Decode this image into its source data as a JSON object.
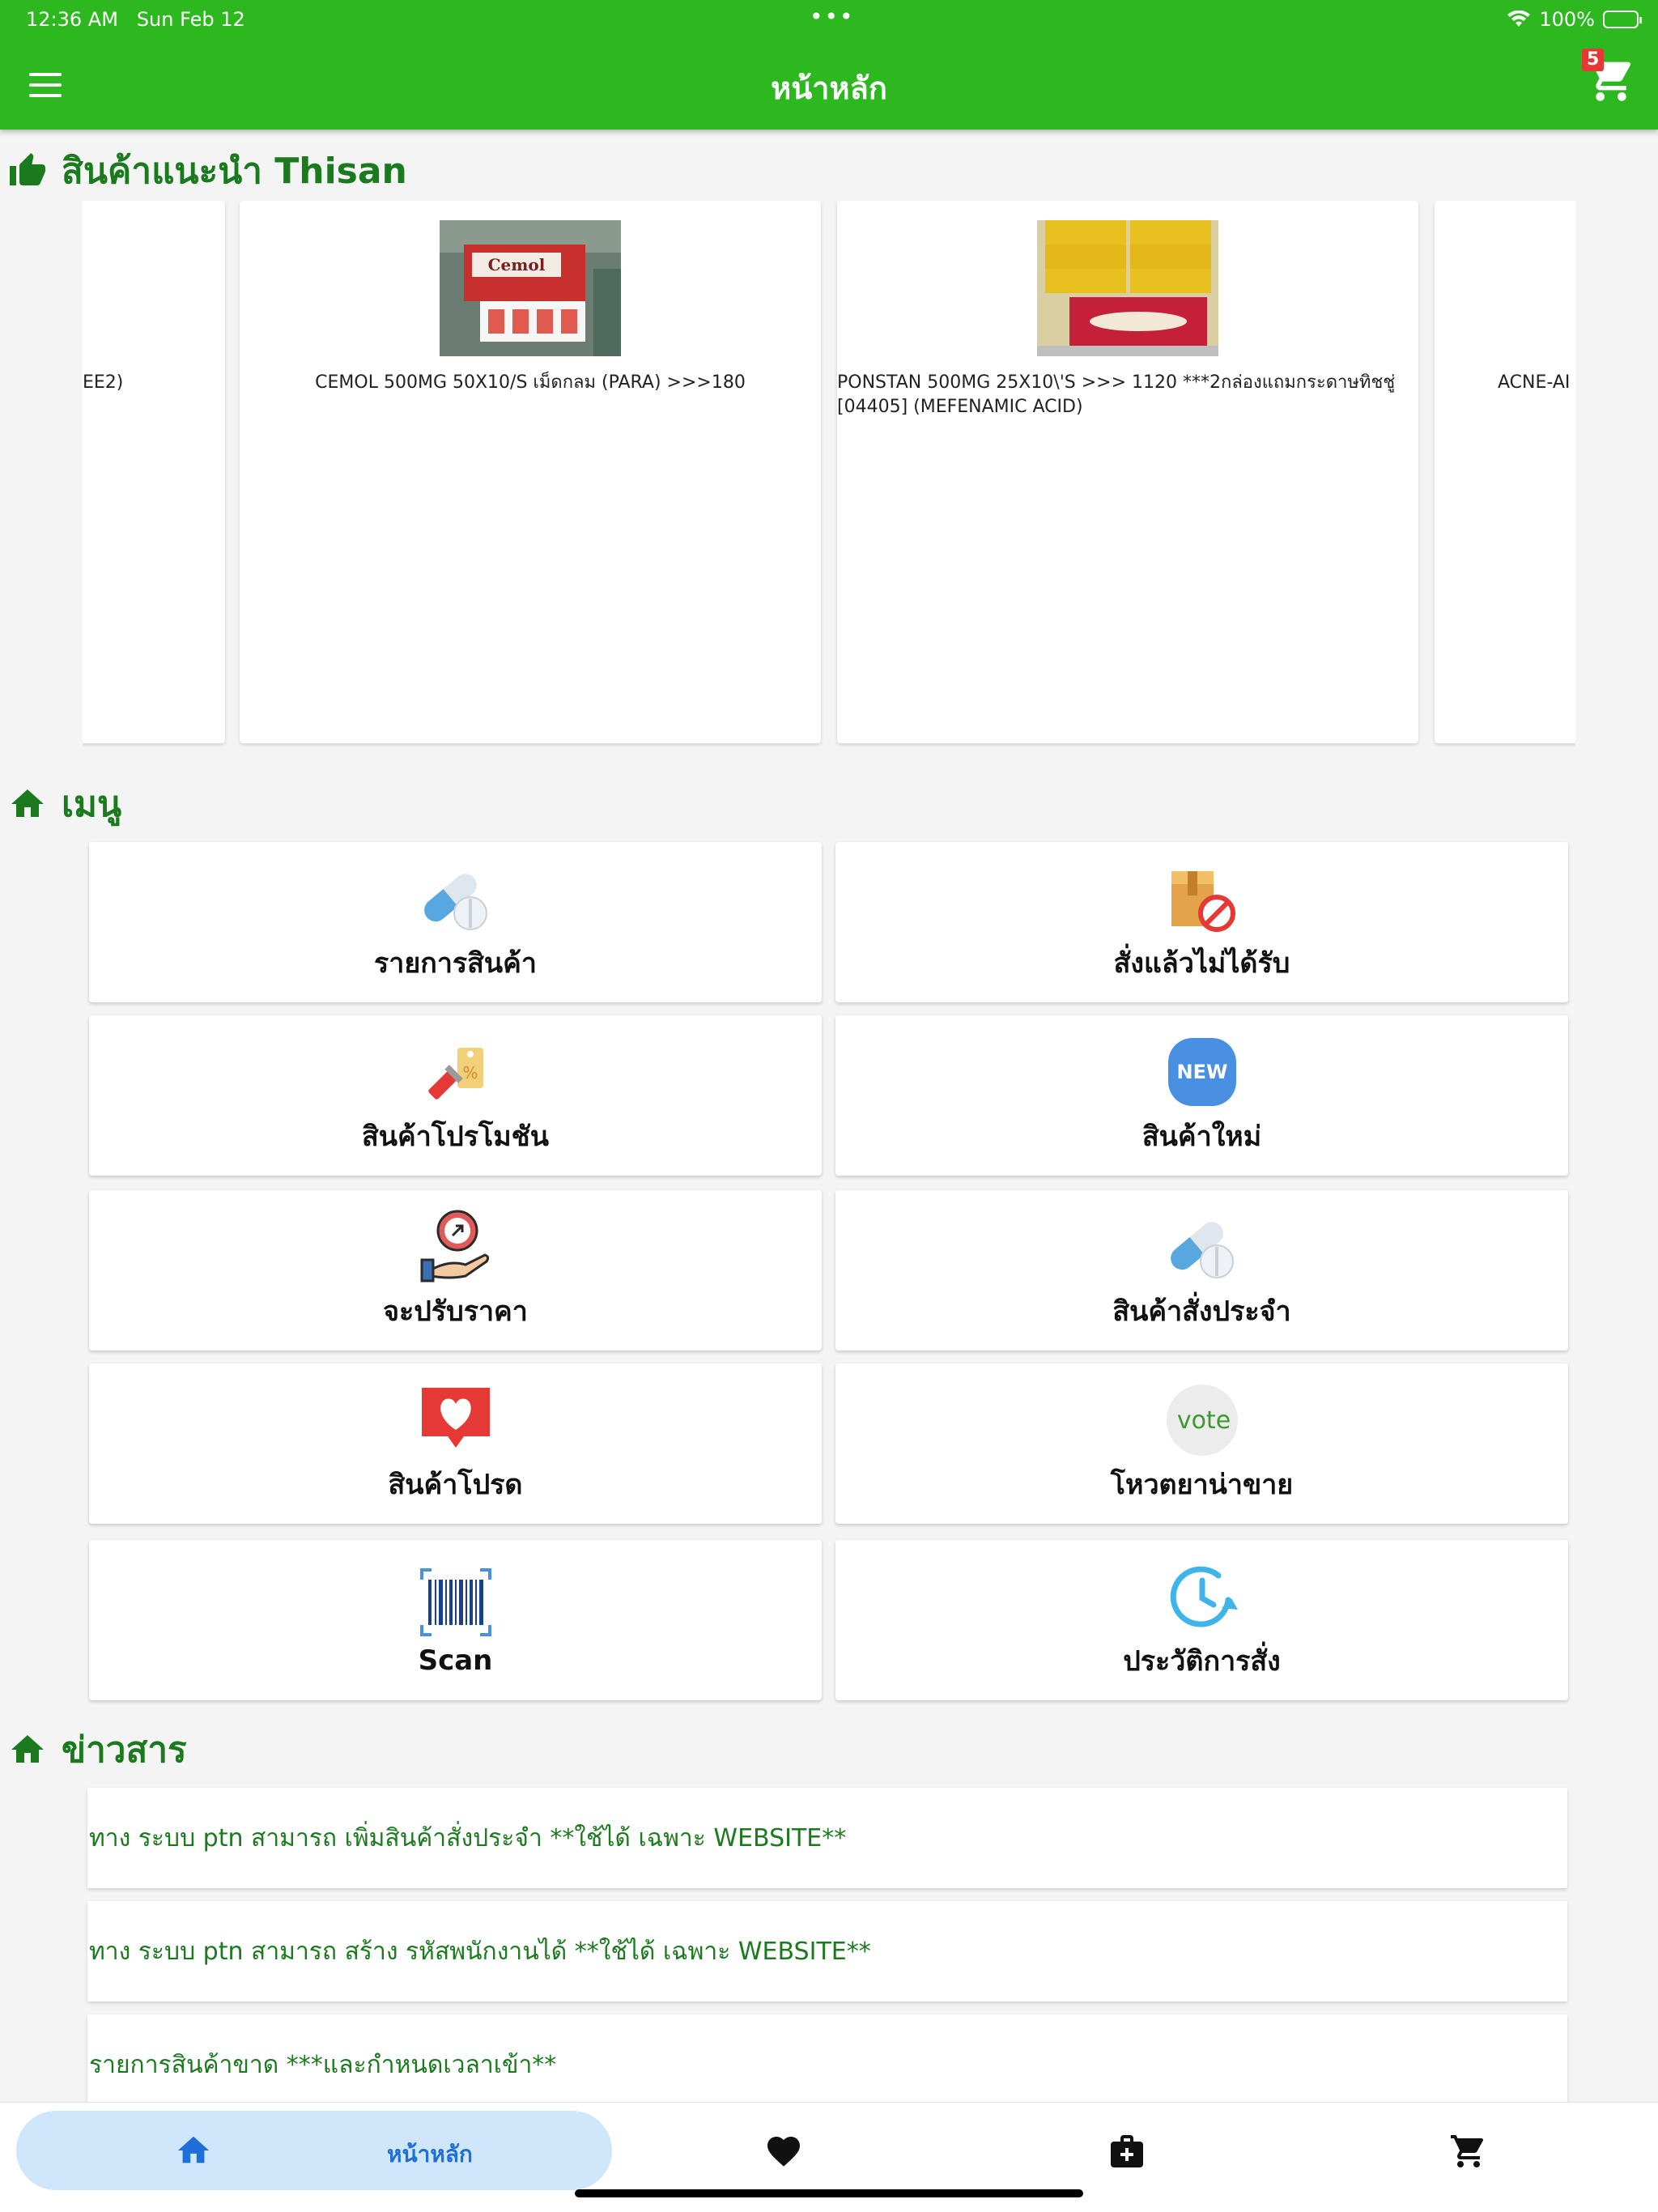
{
  "status": {
    "time": "12:36 AM",
    "date": "Sun Feb 12",
    "battery": "100%"
  },
  "header": {
    "title": "หน้าหลัก",
    "cart_count": "5"
  },
  "recommended": {
    "title": "สินค้าแนะนำ Thisan",
    "products": [
      {
        "name": "EE2)"
      },
      {
        "name": "CEMOL 500MG 50X10/S เม็ดกลม (PARA) >>>180"
      },
      {
        "name": "PONSTAN 500MG 25X10\\'S >>> 1120  ***2กล่องแถมกระดาษทิชชู่ [04405] (MEFENAMIC ACID)"
      },
      {
        "name": "ACNE-AI"
      }
    ]
  },
  "menu": {
    "title": "เมนู",
    "items": [
      {
        "label": "รายการสินค้า",
        "icon": "capsule-icon"
      },
      {
        "label": "สั่งแล้วไม่ได้รับ",
        "icon": "box-blocked-icon"
      },
      {
        "label": "สินค้าโปรโมชัน",
        "icon": "promo-tag-icon"
      },
      {
        "label": "สินค้าใหม่",
        "icon": "new-badge-icon"
      },
      {
        "label": "จะปรับราคา",
        "icon": "price-adjust-icon"
      },
      {
        "label": "สินค้าสั่งประจำ",
        "icon": "capsule-icon"
      },
      {
        "label": "สินค้าโปรด",
        "icon": "heart-message-icon"
      },
      {
        "label": "โหวตยาน่าขาย",
        "icon": "vote-icon"
      },
      {
        "label": "Scan",
        "icon": "barcode-icon"
      },
      {
        "label": "ประวัติการสั่ง",
        "icon": "history-icon"
      }
    ]
  },
  "news": {
    "title": "ข่าวสาร",
    "items": [
      "ทาง ระบบ ptn สามารถ เพิ่มสินค้าสั่งประจำ **ใช้ได้ เฉพาะ WEBSITE**",
      "ทาง ระบบ ptn สามารถ สร้าง รหัสพนักงานได้ **ใช้ได้ เฉพาะ WEBSITE**",
      "รายการสินค้าขาด ***และกำหนดเวลาเข้า**"
    ]
  },
  "nav": {
    "home_label": "หน้าหลัก"
  },
  "colors": {
    "primary": "#2eb81f",
    "section_text": "#1b7a1e",
    "nav_active_bg": "#cfe6fb",
    "nav_active_text": "#1e6fd9"
  }
}
